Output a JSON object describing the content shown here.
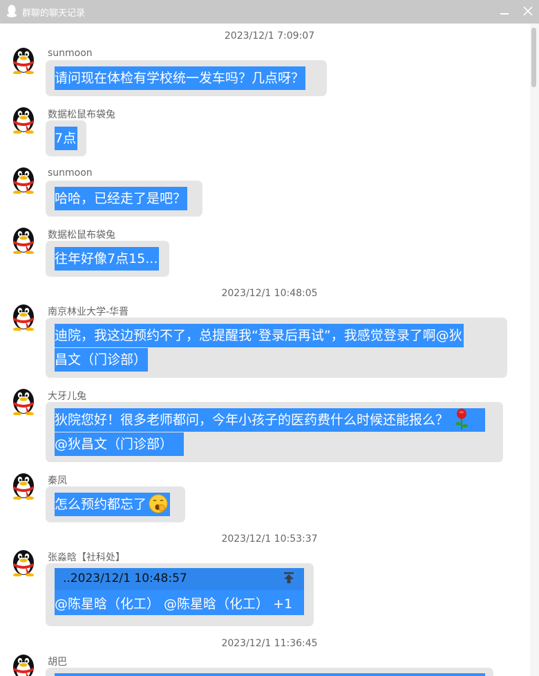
{
  "window": {
    "title": "群聊的聊天记录"
  },
  "timestamps": {
    "t1": "2023/12/1 7:09:07",
    "t2": "2023/12/1 10:48:05",
    "t3": "2023/12/1 10:53:37",
    "t4": "2023/12/1 11:36:45"
  },
  "messages": [
    {
      "sender": "sunmoon",
      "text": "请问现在体检有学校统一发车吗？几点呀？"
    },
    {
      "sender": "数据松鼠布袋兔",
      "text": "7点"
    },
    {
      "sender": "sunmoon",
      "text": "哈哈，已经走了是吧？"
    },
    {
      "sender": "数据松鼠布袋兔",
      "text": "往年好像7点15..."
    },
    {
      "sender": "南京林业大学-华晋",
      "line1": "迪院，我这边预约不了，总提醒我“登录后再试”，我感觉登录了啊@狄",
      "line2": "昌文（门诊部）"
    },
    {
      "sender": "大牙儿兔",
      "line1": "狄院您好！很多老师都问，今年小孩子的医药费什么时候还能报么？",
      "line2": "@狄昌文（门诊部）",
      "emoji": "rose"
    },
    {
      "sender": "秦凤",
      "text": "怎么预约都忘了",
      "emoji": "yawn-face"
    },
    {
      "sender": "张淼晗【社科处】",
      "quote_time": "..2023/12/1 10:48:57",
      "text": "@陈星晗（化工） @陈星晗（化工） +1"
    },
    {
      "sender": "胡巴"
    }
  ],
  "icons": {
    "avatar": "qq-penguin-icon",
    "scroll_to_top": "arrow-to-top-icon",
    "minimize": "minimize-icon",
    "close": "close-icon"
  },
  "colors": {
    "titlebar": "#c8c8c8",
    "bubble": "#e5e5e5",
    "selection": "#3390ff"
  }
}
